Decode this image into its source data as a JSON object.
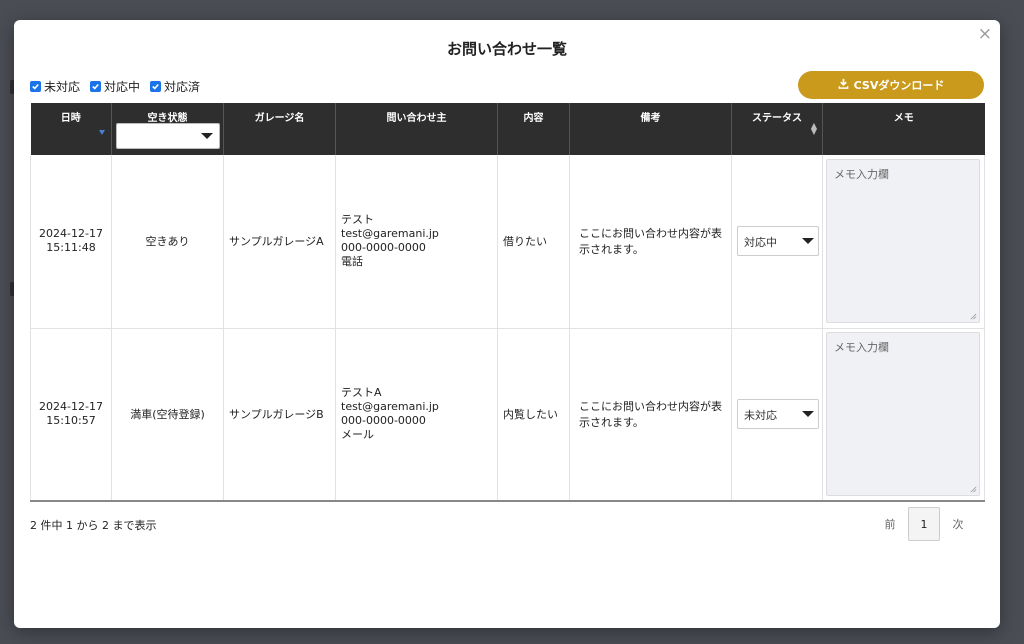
{
  "modal": {
    "title": "お問い合わせ一覧",
    "close_label": "×"
  },
  "filters": [
    {
      "label": "未対応",
      "checked": true
    },
    {
      "label": "対応中",
      "checked": true
    },
    {
      "label": "対応済",
      "checked": true
    }
  ],
  "csv_button": {
    "label": "CSVダウンロード",
    "icon": "download-icon"
  },
  "columns": {
    "datetime": "日時",
    "vacancy": "空き状態",
    "garage": "ガレージ名",
    "inquirer": "問い合わせ主",
    "content": "内容",
    "remarks": "備考",
    "status": "ステータス",
    "memo": "メモ"
  },
  "rows": [
    {
      "date": "2024-12-17",
      "time": "15:11:48",
      "vacancy": "空きあり",
      "garage": "サンプルガレージA",
      "inquirer": {
        "name": "テスト",
        "email": "test@garemani.jp",
        "phone": "000-0000-0000",
        "method": "電話"
      },
      "content": "借りたい",
      "remarks": "ここにお問い合わせ内容が表示されます。",
      "status": "対応中",
      "memo_placeholder": "メモ入力欄"
    },
    {
      "date": "2024-12-17",
      "time": "15:10:57",
      "vacancy": "満車(空待登録)",
      "garage": "サンプルガレージB",
      "inquirer": {
        "name": "テストA",
        "email": "test@garemani.jp",
        "phone": "000-0000-0000",
        "method": "メール"
      },
      "content": "内覧したい",
      "remarks": "ここにお問い合わせ内容が表示されます。",
      "status": "未対応",
      "memo_placeholder": "メモ入力欄"
    }
  ],
  "footer": {
    "info": "2 件中 1 から 2 まで表示",
    "prev": "前",
    "current": "1",
    "next": "次"
  },
  "colors": {
    "accent": "#c99a1c",
    "header_bg": "#2e2e2e",
    "checkbox": "#1a73e8"
  }
}
